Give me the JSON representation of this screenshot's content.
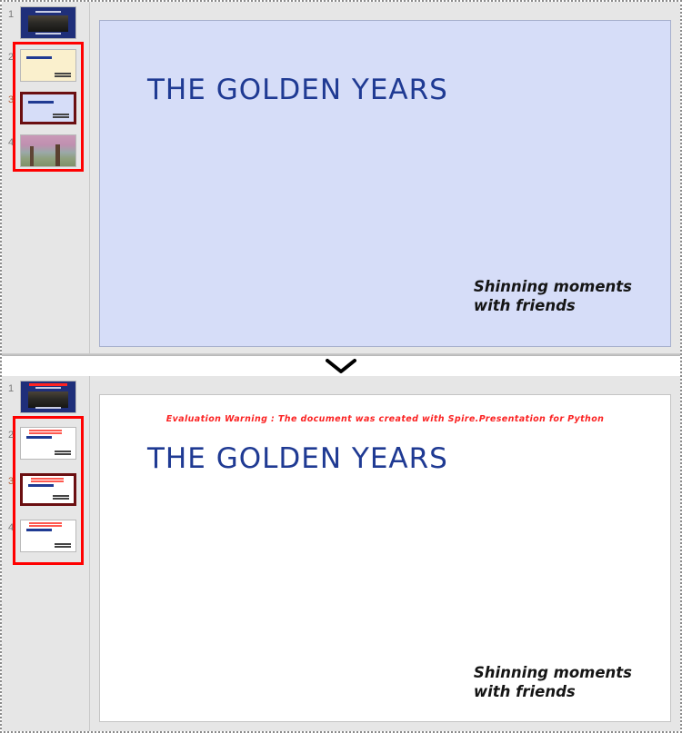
{
  "app": {
    "comparison_separator_icon": "chevron-down-icon"
  },
  "panels": [
    {
      "id": "before",
      "selected_slide_number": "3",
      "thumbnails": [
        {
          "number": "1",
          "kind": "navy-photo",
          "selected": false,
          "in_selection": false
        },
        {
          "number": "2",
          "kind": "cream-title",
          "selected": false,
          "in_selection": true
        },
        {
          "number": "3",
          "kind": "blue-title",
          "selected": true,
          "in_selection": true
        },
        {
          "number": "4",
          "kind": "photo",
          "selected": false,
          "in_selection": true
        }
      ],
      "slide": {
        "background": "#d6ddf8",
        "title": "THE GOLDEN YEARS",
        "title_color": "#1f3a93",
        "subtitle": "Shinning moments\nwith friends",
        "warning": null
      }
    },
    {
      "id": "after",
      "selected_slide_number": "3",
      "thumbnails": [
        {
          "number": "1",
          "kind": "navy-photo",
          "selected": false,
          "in_selection": false
        },
        {
          "number": "2",
          "kind": "white-title",
          "selected": false,
          "in_selection": true
        },
        {
          "number": "3",
          "kind": "white-title",
          "selected": true,
          "in_selection": true
        },
        {
          "number": "4",
          "kind": "white-title",
          "selected": false,
          "in_selection": true
        }
      ],
      "slide": {
        "background": "#ffffff",
        "title": "THE GOLDEN YEARS",
        "title_color": "#1f3a93",
        "subtitle": "Shinning moments\nwith friends",
        "warning": "Evaluation Warning : The document was created with\nSpire.Presentation for Python",
        "warning_color": "#fb2323"
      }
    }
  ]
}
